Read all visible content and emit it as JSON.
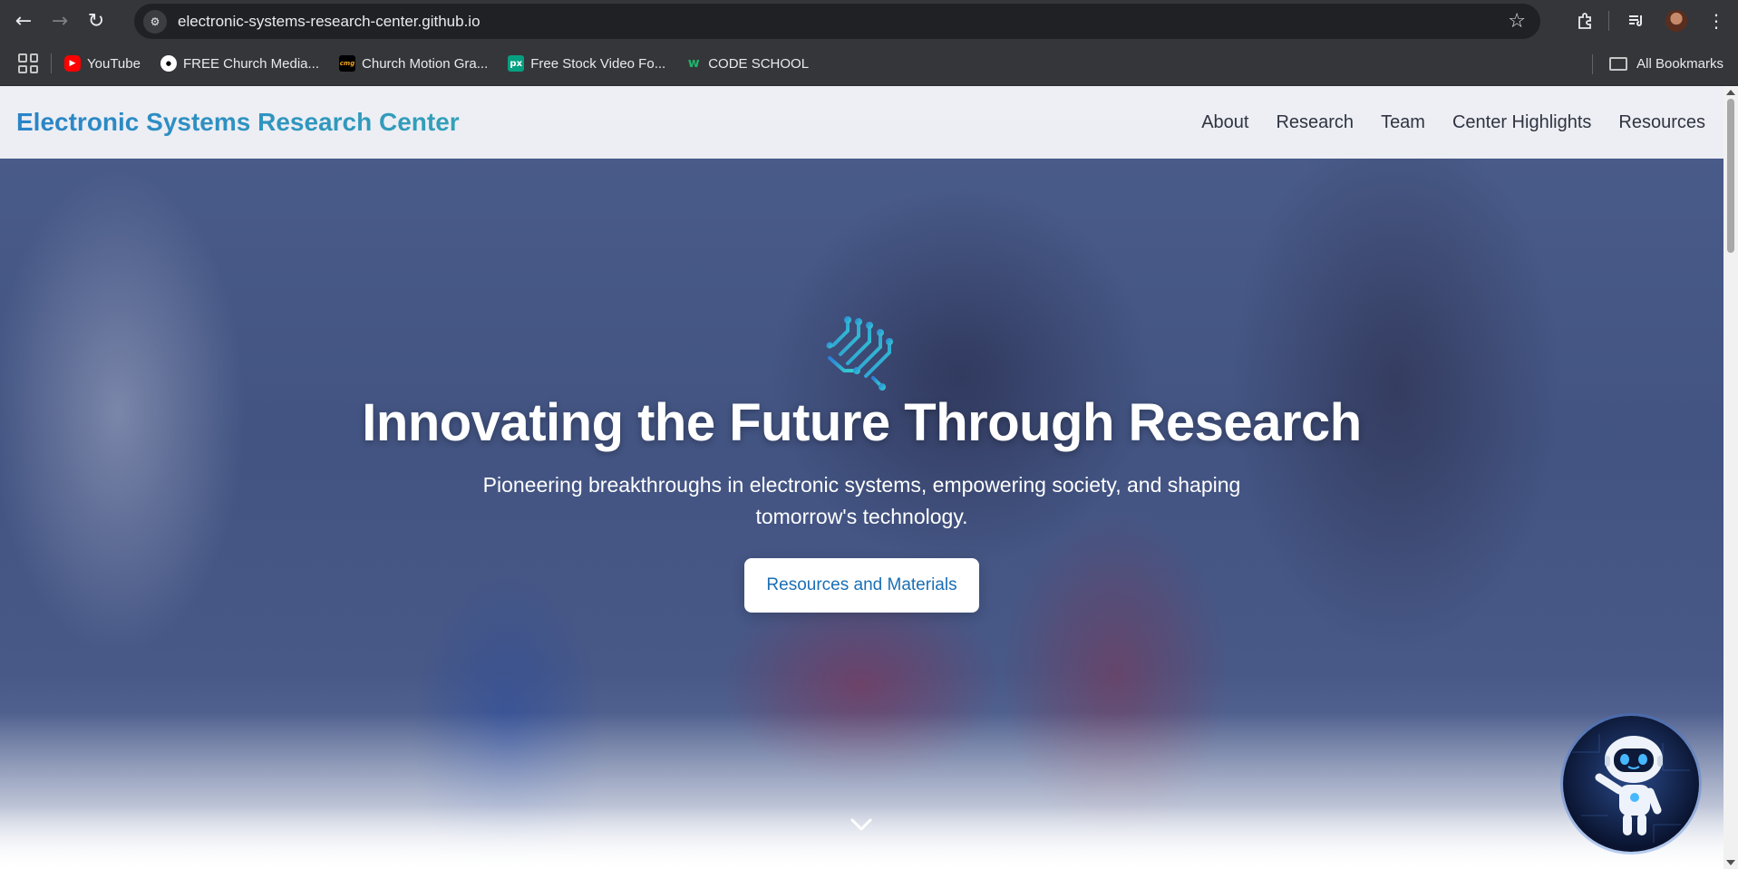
{
  "browser": {
    "url": "electronic-systems-research-center.github.io",
    "bookmarks": [
      {
        "label": "YouTube",
        "icon": "youtube-icon"
      },
      {
        "label": "FREE Church Media...",
        "icon": "church-media-icon"
      },
      {
        "label": "Church Motion Gra...",
        "icon": "cmg-icon"
      },
      {
        "label": "Free Stock Video Fo...",
        "icon": "pixabay-icon"
      },
      {
        "label": "CODE SCHOOL",
        "icon": "code-school-icon"
      }
    ],
    "all_bookmarks_label": "All Bookmarks"
  },
  "site": {
    "brand": "Electronic Systems Research Center",
    "nav": [
      {
        "label": "About"
      },
      {
        "label": "Research"
      },
      {
        "label": "Team"
      },
      {
        "label": "Center Highlights"
      },
      {
        "label": "Resources"
      }
    ],
    "brand_color": "#2b8cc8"
  },
  "hero": {
    "title": "Innovating the Future Through Research",
    "subtitle": "Pioneering breakthroughs in electronic systems, empowering society, and shaping tomorrow's technology.",
    "cta_label": "Resources and Materials",
    "logo_icon": "circuit-logo-icon",
    "scroll_icon": "chevron-down-icon"
  },
  "chatbot": {
    "icon": "robot-icon"
  }
}
